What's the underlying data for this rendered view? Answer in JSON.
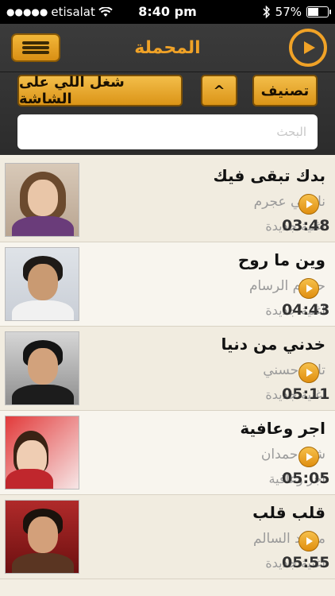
{
  "status_bar": {
    "signal_dots": "●●●●●",
    "carrier": "etisalat",
    "time": "8:40 pm",
    "battery_percent": "57%",
    "battery_level": 0.57
  },
  "header": {
    "title": "المحملة",
    "sort_label": "تصنيف",
    "sort_direction_label": "^",
    "play_on_screen_label": "شغل اللي على الشاشة",
    "search_placeholder": "البحث",
    "accent_color": "#f0a227"
  },
  "songs": [
    {
      "title": "بدك تبقى فيك",
      "artist": "نانسي عجرم",
      "album": "اغنية جديدة",
      "duration": "03:48"
    },
    {
      "title": "وين ما روح",
      "artist": "حسام الرسام",
      "album": "اغنية جديدة",
      "duration": "04:43"
    },
    {
      "title": "خدني من دنيا",
      "artist": "تامر حسني",
      "album": "اغنية جديدة",
      "duration": "05:11"
    },
    {
      "title": "اجر وعافية",
      "artist": "شما حمدان",
      "album": "اجر وعافية",
      "duration": "05:05"
    },
    {
      "title": "قلب قلب",
      "artist": "محمد السالم",
      "album": "اغنية جديدة",
      "duration": "05:55"
    }
  ]
}
